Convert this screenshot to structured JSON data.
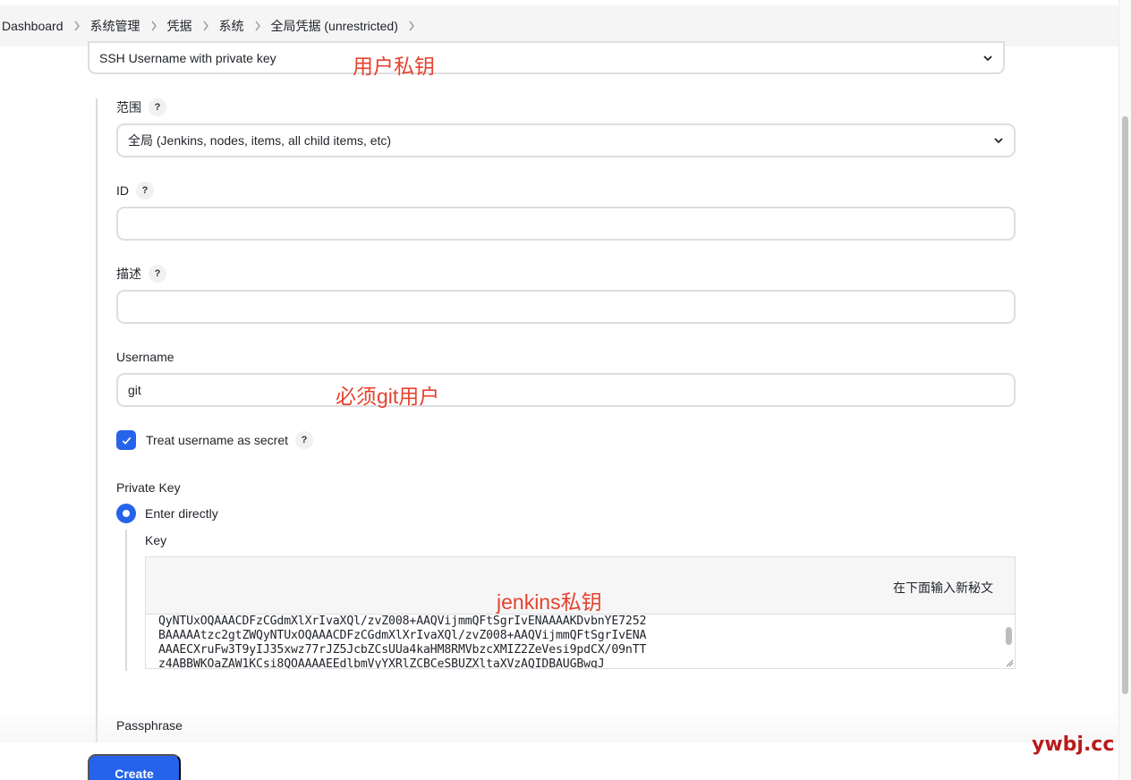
{
  "breadcrumb": [
    "Dashboard",
    "系统管理",
    "凭据",
    "系统",
    "全局凭据 (unrestricted)"
  ],
  "kind_select": {
    "value": "SSH Username with private key"
  },
  "annotations": {
    "kind": "用户私钥",
    "username": "必须git用户",
    "key": "jenkins私钥"
  },
  "scope": {
    "label": "范围",
    "help": "?",
    "value": "全局 (Jenkins, nodes, items, all child items, etc)"
  },
  "id_field": {
    "label": "ID",
    "help": "?",
    "value": ""
  },
  "description": {
    "label": "描述",
    "help": "?",
    "value": ""
  },
  "username": {
    "label": "Username",
    "value": "git"
  },
  "treat_secret": {
    "label": "Treat username as secret",
    "help": "?",
    "checked": true
  },
  "private_key": {
    "label": "Private Key",
    "option_label": "Enter directly",
    "key_label": "Key",
    "hint": "在下面输入新秘文",
    "lines": [
      "QyNTUxOQAAACDFzCGdmXlXrIvaXQl/zvZ008+AAQVijmmQFtSgrIvENAAAAKDvbnYE7252",
      "BAAAAAtzc2gtZWQyNTUxOQAAACDFzCGdmXlXrIvaXQl/zvZ008+AAQVijmmQFtSgrIvENA",
      "AAAECXruFw3T9yIJ35xwz77rJZ5JcbZCsUUa4kaHM8RMVbzcXMIZ2ZeVesi9pdCX/09nTT",
      "z4ABBWKOaZAW1KCsi8QOAAAAEEdlbmVyYXRlZCBCeSBUZXltaXVzAQIDBAUGBwgJ"
    ]
  },
  "passphrase": {
    "label": "Passphrase"
  },
  "create_button": "Create",
  "watermark": "ywbj.cc"
}
